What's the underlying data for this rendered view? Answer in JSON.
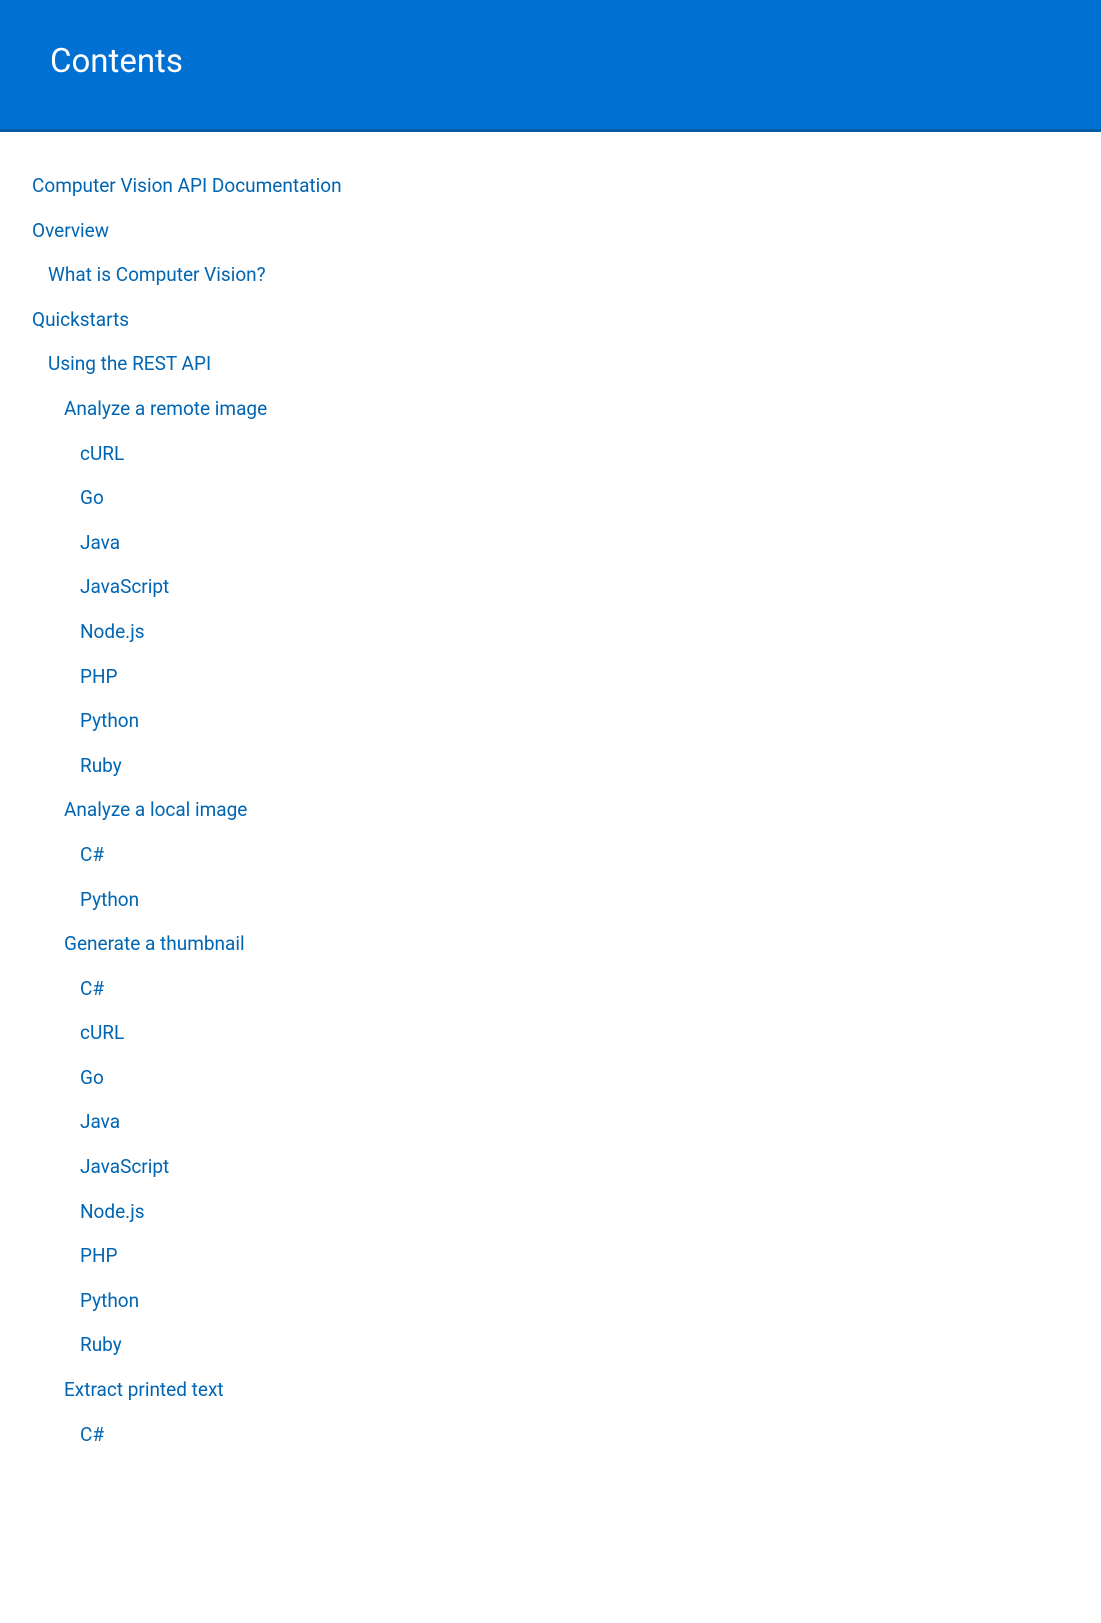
{
  "header": {
    "title": "Contents"
  },
  "toc": [
    {
      "label": "Computer Vision API Documentation",
      "level": 0
    },
    {
      "label": "Overview",
      "level": 0
    },
    {
      "label": "What is Computer Vision?",
      "level": 1
    },
    {
      "label": "Quickstarts",
      "level": 0
    },
    {
      "label": "Using the REST API",
      "level": 1
    },
    {
      "label": "Analyze a remote image",
      "level": 2
    },
    {
      "label": "cURL",
      "level": 3
    },
    {
      "label": "Go",
      "level": 3
    },
    {
      "label": "Java",
      "level": 3
    },
    {
      "label": "JavaScript",
      "level": 3
    },
    {
      "label": "Node.js",
      "level": 3
    },
    {
      "label": "PHP",
      "level": 3
    },
    {
      "label": "Python",
      "level": 3
    },
    {
      "label": "Ruby",
      "level": 3
    },
    {
      "label": "Analyze a local image",
      "level": 2
    },
    {
      "label": "C#",
      "level": 3
    },
    {
      "label": "Python",
      "level": 3
    },
    {
      "label": "Generate a thumbnail",
      "level": 2
    },
    {
      "label": "C#",
      "level": 3
    },
    {
      "label": "cURL",
      "level": 3
    },
    {
      "label": "Go",
      "level": 3
    },
    {
      "label": "Java",
      "level": 3
    },
    {
      "label": "JavaScript",
      "level": 3
    },
    {
      "label": "Node.js",
      "level": 3
    },
    {
      "label": "PHP",
      "level": 3
    },
    {
      "label": "Python",
      "level": 3
    },
    {
      "label": "Ruby",
      "level": 3
    },
    {
      "label": "Extract printed text",
      "level": 2
    },
    {
      "label": "C#",
      "level": 3
    }
  ]
}
